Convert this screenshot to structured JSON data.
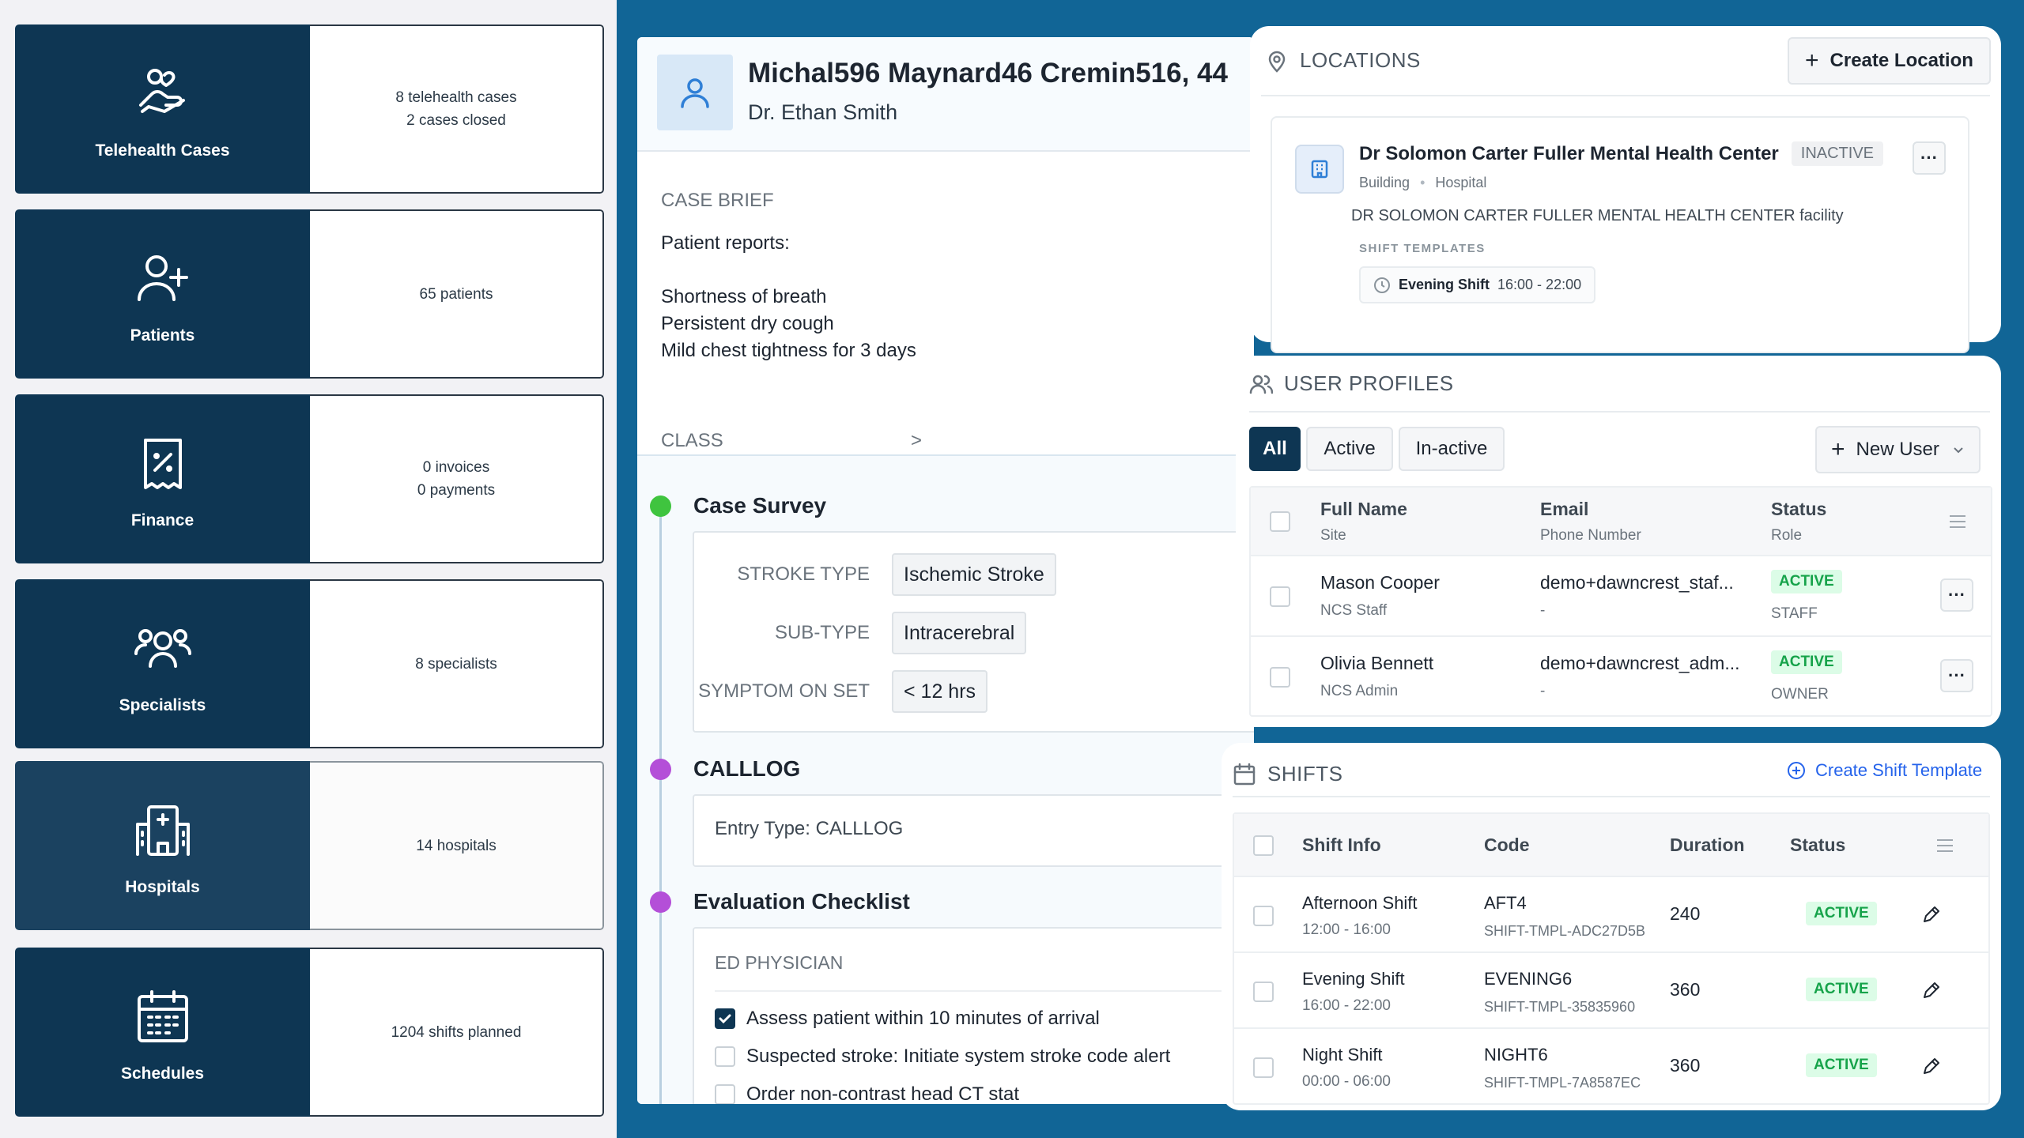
{
  "dashboard": {
    "cards": [
      {
        "label": "Telehealth Cases",
        "icon": "hand-heart-icon",
        "line1": "8 telehealth cases",
        "line2": "2 cases closed"
      },
      {
        "label": "Patients",
        "icon": "user-plus-icon",
        "line1": "65 patients",
        "line2": ""
      },
      {
        "label": "Finance",
        "icon": "receipt-percent-icon",
        "line1": "0 invoices",
        "line2": "0 payments"
      },
      {
        "label": "Specialists",
        "icon": "users-group-icon",
        "line1": "8 specialists",
        "line2": ""
      },
      {
        "label": "Hospitals",
        "icon": "hospital-icon",
        "line1": "14 hospitals",
        "line2": ""
      },
      {
        "label": "Schedules",
        "icon": "calendar-icon",
        "line1": "1204 shifts planned",
        "line2": ""
      }
    ]
  },
  "case": {
    "patient_name": "Michal596 Maynard46 Cremin516, 44",
    "doctor": "Dr. Ethan Smith",
    "brief_title": "CASE BRIEF",
    "brief_lines": [
      "Patient reports:",
      "",
      "Shortness of breath",
      "Persistent dry cough",
      "Mild chest tightness for 3 days"
    ],
    "class_label": "CLASS",
    "class_chevron": ">",
    "survey": {
      "title": "Case Survey",
      "fields": [
        {
          "key": "STROKE TYPE",
          "value": "Ischemic Stroke"
        },
        {
          "key": "SUB-TYPE",
          "value": "Intracerebral"
        },
        {
          "key": "SYMPTOM ON SET",
          "value": "< 12 hrs"
        }
      ]
    },
    "calllog": {
      "title": "CALLLOG",
      "entry": "Entry Type: CALLLOG"
    },
    "checklist": {
      "title": "Evaluation Checklist",
      "group": "ED PHYSICIAN",
      "items": [
        {
          "text": "Assess patient within 10 minutes of arrival",
          "checked": true
        },
        {
          "text": "Suspected stroke: Initiate system stroke code alert",
          "checked": false
        },
        {
          "text": "Order non-contrast head CT stat",
          "checked": false
        }
      ]
    },
    "colors": {
      "survey_dot": "#3fc43f",
      "calllog_dot": "#b44fd8",
      "checklist_dot": "#b44fd8"
    }
  },
  "locations": {
    "title": "LOCATIONS",
    "create_label": "Create Location",
    "item": {
      "name": "Dr Solomon Carter Fuller Mental Health Center",
      "status": "INACTIVE",
      "type": "Building",
      "category": "Hospital",
      "description": "DR SOLOMON CARTER FULLER MENTAL HEALTH CENTER facility",
      "templates_label": "SHIFT TEMPLATES",
      "shift_name": "Evening Shift",
      "shift_time": "16:00 - 22:00"
    }
  },
  "users": {
    "title": "USER PROFILES",
    "tabs": [
      "All",
      "Active",
      "In-active"
    ],
    "new_label": "New User",
    "headers": {
      "name": "Full Name",
      "name_sub": "Site",
      "email": "Email",
      "email_sub": "Phone Number",
      "status": "Status",
      "status_sub": "Role"
    },
    "rows": [
      {
        "name": "Mason Cooper",
        "site": "NCS Staff",
        "email": "demo+dawncrest_staf...",
        "phone": "-",
        "status": "ACTIVE",
        "role": "STAFF"
      },
      {
        "name": "Olivia Bennett",
        "site": "NCS Admin",
        "email": "demo+dawncrest_adm...",
        "phone": "-",
        "status": "ACTIVE",
        "role": "OWNER"
      }
    ]
  },
  "shifts": {
    "title": "SHIFTS",
    "create_label": "Create Shift Template",
    "headers": {
      "info": "Shift Info",
      "code": "Code",
      "duration": "Duration",
      "status": "Status"
    },
    "rows": [
      {
        "name": "Afternoon Shift",
        "time": "12:00 - 16:00",
        "code": "AFT4",
        "code_id": "SHIFT-TMPL-ADC27D5B",
        "duration": "240",
        "status": "ACTIVE"
      },
      {
        "name": "Evening Shift",
        "time": "16:00 - 22:00",
        "code": "EVENING6",
        "code_id": "SHIFT-TMPL-35835960",
        "duration": "360",
        "status": "ACTIVE"
      },
      {
        "name": "Night Shift",
        "time": "00:00 - 06:00",
        "code": "NIGHT6",
        "code_id": "SHIFT-TMPL-7A8587EC",
        "duration": "360",
        "status": "ACTIVE"
      }
    ]
  },
  "colors": {
    "nav_dark": "#0e3653",
    "bg_blue": "#116596",
    "active_green": "#16a34a",
    "link_blue": "#2563eb"
  }
}
